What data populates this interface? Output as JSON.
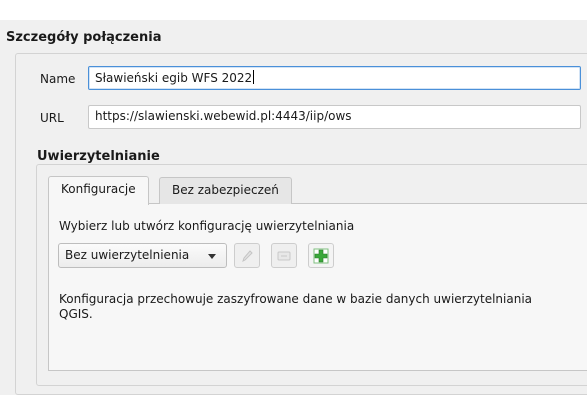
{
  "connection_details": {
    "title": "Szczegóły połączenia",
    "name_label": "Name",
    "name_value": "Sławieński egib WFS 2022",
    "url_label": "URL",
    "url_value": "https://slawienski.webewid.pl:4443/iip/ows"
  },
  "authentication": {
    "title": "Uwierzytelnianie",
    "tabs": [
      {
        "label": "Konfiguracje",
        "active": true
      },
      {
        "label": "Bez zabezpieczeń",
        "active": false
      }
    ],
    "prompt": "Wybierz lub utwórz konfigurację uwierzytelniania",
    "config_select": {
      "selected": "Bez uwierzytelnienia"
    },
    "buttons": [
      {
        "icon": "pencil-icon",
        "enabled": false
      },
      {
        "icon": "remove-icon",
        "enabled": false
      },
      {
        "icon": "add-icon",
        "enabled": true
      }
    ],
    "info_line1": "Konfiguracja przechowuje zaszyfrowane dane w bazie danych uwierzytelniania",
    "info_line2": "QGIS."
  },
  "colors": {
    "focus_border": "#4a90d9",
    "add_icon_green": "#3aa83a"
  }
}
